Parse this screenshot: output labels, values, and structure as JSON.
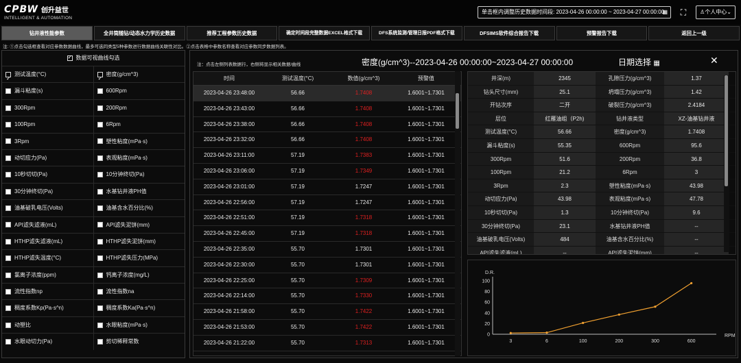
{
  "header": {
    "logo_text": "CPBW",
    "logo_cn": "创升益世",
    "logo_en": "INTELLIGENT & AUTOMATION",
    "date_range": "单击框内调整历史数据时间段:  2023-04-26 00:00:00 ~ 2023-04-27 00:00:00",
    "user_menu": "个人中心"
  },
  "nav": [
    {
      "label": "钻井液性能参数",
      "active": true
    },
    {
      "label": "全井筒随钻/动态水力学历史数据",
      "active": false
    },
    {
      "label": "推荐工程参数历史数据",
      "active": false
    },
    {
      "label": "确定时间段完整数据EXCEL格式下载",
      "active": false
    },
    {
      "label": "DFS系统监测/管理日报PDF格式下载",
      "active": false
    },
    {
      "label": "DFSIMS软件综合报告下载",
      "active": false
    },
    {
      "label": "预警报告下载",
      "active": false
    },
    {
      "label": "返回上一级",
      "active": false
    }
  ],
  "note": "注: ①点击勾选框查看对应参数数据曲线，最多可选同类型5种参数进行数据曲线关联性对比。②点击表格中参数名称查看对应参数同步数据列表。",
  "left_panel": {
    "title": "数据可视曲线勾选",
    "title_checked": true,
    "rows": [
      [
        {
          "label": "测试温度(°C)",
          "checked": true
        },
        {
          "label": "密度(g/cm^3)",
          "checked": true
        }
      ],
      [
        {
          "label": "漏斗粘度(s)",
          "checked": false
        },
        {
          "label": "600Rpm",
          "checked": false
        }
      ],
      [
        {
          "label": "300Rpm",
          "checked": false
        },
        {
          "label": "200Rpm",
          "checked": false
        }
      ],
      [
        {
          "label": "100Rpm",
          "checked": false
        },
        {
          "label": "6Rpm",
          "checked": false
        }
      ],
      [
        {
          "label": "3Rpm",
          "checked": false
        },
        {
          "label": "塑性粘度(mPa·s)",
          "checked": false
        }
      ],
      [
        {
          "label": "动切应力(Pa)",
          "checked": false
        },
        {
          "label": "表观粘度(mPa·s)",
          "checked": false
        }
      ],
      [
        {
          "label": "10秒切切(Pa)",
          "checked": false
        },
        {
          "label": "10分钟终切(Pa)",
          "checked": false
        }
      ],
      [
        {
          "label": "30分钟终切(Pa)",
          "checked": false
        },
        {
          "label": "水基钻井液PH值",
          "checked": false
        }
      ],
      [
        {
          "label": "油基破乳电压(Volts)",
          "checked": false
        },
        {
          "label": "油基含水百分比(%)",
          "checked": false
        }
      ],
      [
        {
          "label": "API滤失滤液(mL)",
          "checked": false
        },
        {
          "label": "API滤失泥饼(mm)",
          "checked": false
        }
      ],
      [
        {
          "label": "HTHP滤失滤液(mL)",
          "checked": false
        },
        {
          "label": "HTHP滤失泥饼(mm)",
          "checked": false
        }
      ],
      [
        {
          "label": "HTHP滤失温度(°C)",
          "checked": false
        },
        {
          "label": "HTHP滤失压力(MPa)",
          "checked": false
        }
      ],
      [
        {
          "label": "氯离子浓度(ppm)",
          "checked": false
        },
        {
          "label": "钙离子浓度(mg/L)",
          "checked": false
        }
      ],
      [
        {
          "label": "流性指数np",
          "checked": false
        },
        {
          "label": "流性指数na",
          "checked": false
        }
      ],
      [
        {
          "label": "稠度系数Kp(Pa·s^n)",
          "checked": false
        },
        {
          "label": "稠度系数Ka(Pa·s^n)",
          "checked": false
        }
      ],
      [
        {
          "label": "动塑比",
          "checked": false
        },
        {
          "label": "水眼粘度(mPa·s)",
          "checked": false
        }
      ],
      [
        {
          "label": "水眼动切力(Pa)",
          "checked": false
        },
        {
          "label": "剪切稀释常数",
          "checked": false
        }
      ]
    ]
  },
  "main": {
    "tip": "注：点击左侧列表数据行，右侧将显示相关数据/曲线",
    "title": "密度(g/cm^3)--2023-04-26 00:00:00~2023-04-27 00:00:00",
    "date_select": "日期选择",
    "table": {
      "headers": [
        "时间",
        "测试温度(°C)",
        "数值(g/cm^3)",
        "预警值"
      ],
      "rows": [
        {
          "time": "2023-04-26 23:48:00",
          "temp": "56.66",
          "value": "1.7408",
          "warn": "1.6001~1.7301",
          "alert": true,
          "selected": true
        },
        {
          "time": "2023-04-26 23:43:00",
          "temp": "56.66",
          "value": "1.7408",
          "warn": "1.6001~1.7301",
          "alert": true
        },
        {
          "time": "2023-04-26 23:38:00",
          "temp": "56.66",
          "value": "1.7408",
          "warn": "1.6001~1.7301",
          "alert": true
        },
        {
          "time": "2023-04-26 23:32:00",
          "temp": "56.66",
          "value": "1.7408",
          "warn": "1.6001~1.7301",
          "alert": true
        },
        {
          "time": "2023-04-26 23:11:00",
          "temp": "57.19",
          "value": "1.7383",
          "warn": "1.6001~1.7301",
          "alert": true
        },
        {
          "time": "2023-04-26 23:06:00",
          "temp": "57.19",
          "value": "1.7349",
          "warn": "1.6001~1.7301",
          "alert": true
        },
        {
          "time": "2023-04-26 23:01:00",
          "temp": "57.19",
          "value": "1.7247",
          "warn": "1.6001~1.7301",
          "alert": false
        },
        {
          "time": "2023-04-26 22:56:00",
          "temp": "57.19",
          "value": "1.7247",
          "warn": "1.6001~1.7301",
          "alert": false
        },
        {
          "time": "2023-04-26 22:51:00",
          "temp": "57.19",
          "value": "1.7318",
          "warn": "1.6001~1.7301",
          "alert": true
        },
        {
          "time": "2023-04-26 22:45:00",
          "temp": "57.19",
          "value": "1.7318",
          "warn": "1.6001~1.7301",
          "alert": true
        },
        {
          "time": "2023-04-26 22:35:00",
          "temp": "55.70",
          "value": "1.7301",
          "warn": "1.6001~1.7301",
          "alert": false
        },
        {
          "time": "2023-04-26 22:30:00",
          "temp": "55.70",
          "value": "1.7301",
          "warn": "1.6001~1.7301",
          "alert": false
        },
        {
          "time": "2023-04-26 22:25:00",
          "temp": "55.70",
          "value": "1.7309",
          "warn": "1.6001~1.7301",
          "alert": true
        },
        {
          "time": "2023-04-26 22:14:00",
          "temp": "55.70",
          "value": "1.7330",
          "warn": "1.6001~1.7301",
          "alert": true
        },
        {
          "time": "2023-04-26 21:58:00",
          "temp": "55.70",
          "value": "1.7422",
          "warn": "1.6001~1.7301",
          "alert": true
        },
        {
          "time": "2023-04-26 21:53:00",
          "temp": "55.70",
          "value": "1.7422",
          "warn": "1.6001~1.7301",
          "alert": true
        },
        {
          "time": "2023-04-26 21:22:00",
          "temp": "55.70",
          "value": "1.7313",
          "warn": "1.6001~1.7301",
          "alert": true
        },
        {
          "time": "2023-04-26 21:17:00",
          "temp": "55.70",
          "value": "1.7313",
          "warn": "1.6001~1.7301",
          "alert": true
        }
      ]
    },
    "props": [
      [
        "井深(m)",
        "2345",
        "孔隙压力(g/cm^3)",
        "1.37"
      ],
      [
        "钻头尺寸(mm)",
        "25.1",
        "坍塌压力(g/cm^3)",
        "1.42"
      ],
      [
        "开钻次序",
        "二开",
        "破裂压力(g/cm^3)",
        "2.4184"
      ],
      [
        "层位",
        "红雁油组（P2h)",
        "钻井液类型",
        "XZ-油基钻井液"
      ],
      [
        "测试温度(°C)",
        "56.66",
        "密度(g/cm^3)",
        "1.7408"
      ],
      [
        "漏斗粘度(s)",
        "55.35",
        "600Rpm",
        "95.6"
      ],
      [
        "300Rpm",
        "51.6",
        "200Rpm",
        "36.8"
      ],
      [
        "100Rpm",
        "21.2",
        "6Rpm",
        "3"
      ],
      [
        "3Rpm",
        "2.3",
        "塑性粘度(mPa·s)",
        "43.98"
      ],
      [
        "动切应力(Pa)",
        "43.98",
        "表观粘度(mPa·s)",
        "47.78"
      ],
      [
        "10秒切切(Pa)",
        "1.3",
        "10分钟终切(Pa)",
        "9.6"
      ],
      [
        "30分钟终切(Pa)",
        "23.1",
        "水基钻井液PH值",
        "--"
      ],
      [
        "油基破乳电压(Volts)",
        "484",
        "油基含水百分比(%)",
        "--"
      ],
      [
        "API滤失滤液(mL)",
        "--",
        "API滤失泥饼(mm)",
        "--"
      ]
    ]
  },
  "chart_data": {
    "type": "line",
    "categories": [
      "3",
      "6",
      "100",
      "200",
      "300",
      "600"
    ],
    "series": [
      {
        "values": [
          2.3,
          3,
          21.2,
          36.8,
          51.6,
          95.6
        ]
      }
    ],
    "ylabel": "D.R.",
    "xlabel": "RPM",
    "yticks": [
      "0",
      "20",
      "40",
      "60",
      "80",
      "100"
    ],
    "ylim": [
      0,
      100
    ],
    "grid": false,
    "color": "#f0a030"
  }
}
